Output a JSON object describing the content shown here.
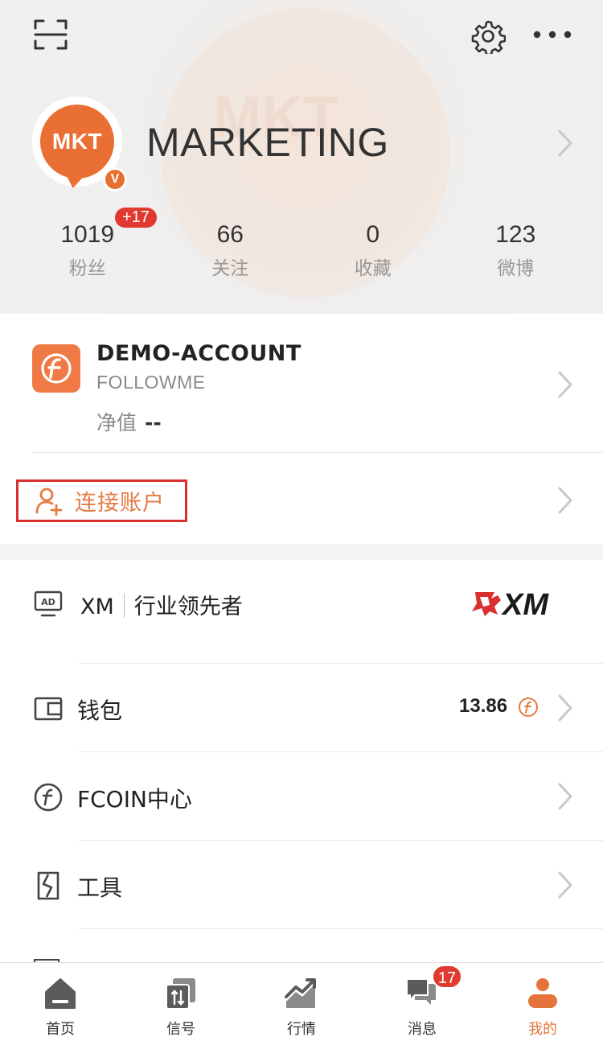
{
  "header": {
    "watermark_text": "MKT",
    "icons": [
      "scan-icon",
      "gear-icon",
      "more-icon"
    ]
  },
  "profile": {
    "avatar_text": "MKT",
    "verified_badge": "V",
    "name": "MARKETING"
  },
  "stats": [
    {
      "value": "1019",
      "label": "粉丝",
      "badge": "+17"
    },
    {
      "value": "66",
      "label": "关注"
    },
    {
      "value": "0",
      "label": "收藏"
    },
    {
      "value": "123",
      "label": "微博"
    }
  ],
  "account": {
    "name": "DEMO-ACCOUNT",
    "broker": "FOLLOWME",
    "equity_label": "净值",
    "equity_value": "--",
    "connect_label": "连接账户"
  },
  "menu": {
    "ad": {
      "brand": "XM",
      "slogan": "行业领先者",
      "logo_text": "XM"
    },
    "wallet": {
      "label": "钱包",
      "value": "13.86"
    },
    "fcoin": {
      "label": "FCOIN中心"
    },
    "tools": {
      "label": "工具"
    }
  },
  "tabbar": [
    {
      "label": "首页"
    },
    {
      "label": "信号"
    },
    {
      "label": "行情"
    },
    {
      "label": "消息",
      "badge": "17"
    },
    {
      "label": "我的"
    }
  ],
  "colors": {
    "accent": "#e5733a",
    "badge_red": "#e0392f",
    "highlight_border": "#d9302f"
  }
}
